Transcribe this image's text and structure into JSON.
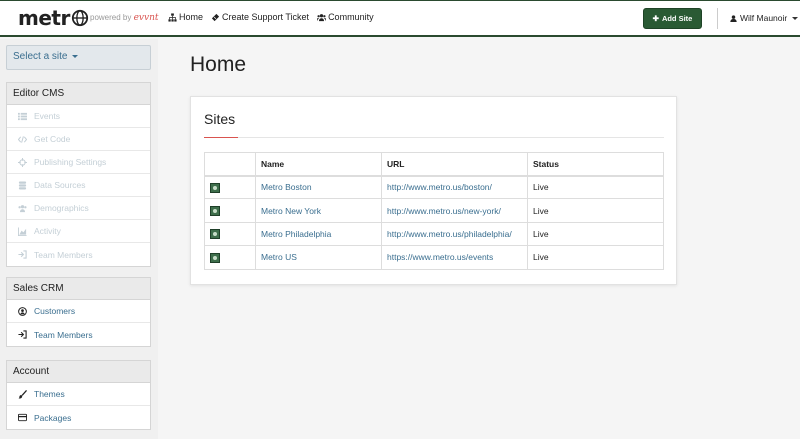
{
  "brand": {
    "logo_text": "metr",
    "powered_by": "powered by",
    "powered_brand": "evvnt"
  },
  "nav": [
    {
      "label": "Home",
      "icon": "sitemap-icon"
    },
    {
      "label": "Create Support Ticket",
      "icon": "ticket-icon"
    },
    {
      "label": "Community",
      "icon": "users-icon"
    }
  ],
  "toolbar": {
    "add_site_label": "Add Site",
    "user_name": "Wilf Maunoir"
  },
  "sidebar": {
    "select_site": "Select a site",
    "editor": {
      "title": "Editor CMS",
      "items": [
        {
          "label": "Events",
          "icon": "list-icon"
        },
        {
          "label": "Get Code",
          "icon": "code-icon"
        },
        {
          "label": "Publishing Settings",
          "icon": "crosshairs-icon"
        },
        {
          "label": "Data Sources",
          "icon": "database-icon"
        },
        {
          "label": "Demographics",
          "icon": "users-icon"
        },
        {
          "label": "Activity",
          "icon": "area-chart-icon"
        },
        {
          "label": "Team Members",
          "icon": "sign-in-icon"
        }
      ]
    },
    "sales": {
      "title": "Sales CRM",
      "items": [
        {
          "label": "Customers",
          "icon": "user-circle-icon"
        },
        {
          "label": "Team Members",
          "icon": "sign-in-icon"
        }
      ]
    },
    "account": {
      "title": "Account",
      "items": [
        {
          "label": "Themes",
          "icon": "paintbrush-icon"
        },
        {
          "label": "Packages",
          "icon": "credit-card-icon"
        }
      ]
    }
  },
  "main": {
    "page_title": "Home",
    "card_title": "Sites",
    "table": {
      "headers": [
        "",
        "Name",
        "URL",
        "Status"
      ],
      "rows": [
        {
          "name": "Metro Boston",
          "url": "http://www.metro.us/boston/",
          "status": "Live"
        },
        {
          "name": "Metro New York",
          "url": "http://www.metro.us/new-york/",
          "status": "Live"
        },
        {
          "name": "Metro Philadelphia",
          "url": "http://www.metro.us/philadelphia/",
          "status": "Live"
        },
        {
          "name": "Metro US",
          "url": "https://www.metro.us/events",
          "status": "Live"
        }
      ]
    }
  },
  "colors": {
    "accent_green": "#2a5a34",
    "link": "#3a6e8f",
    "rule_accent": "#d9534f"
  }
}
